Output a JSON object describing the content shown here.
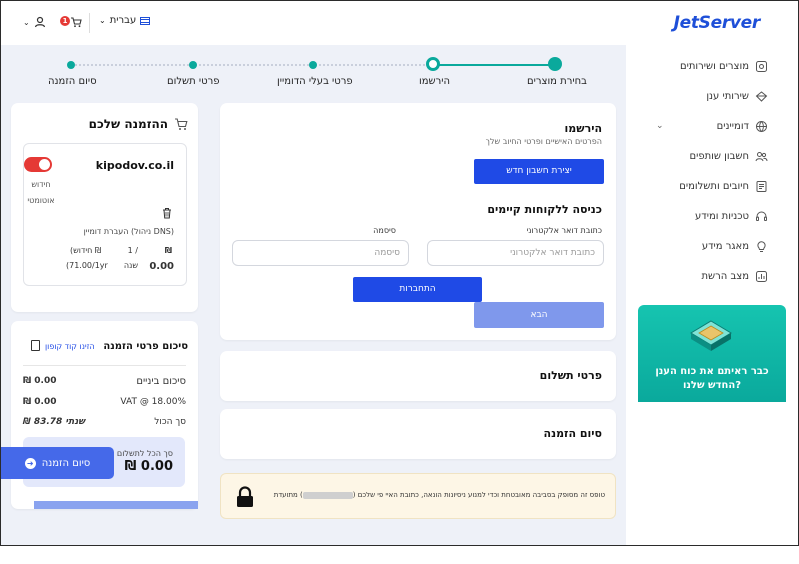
{
  "header": {
    "logo": "JetServer",
    "language": "עברית",
    "cart_badge": "1"
  },
  "sidebar": {
    "items": [
      {
        "label": "מוצרים ושירותים",
        "icon": "products-icon"
      },
      {
        "label": "שירותי ענן",
        "icon": "cloud-icon"
      },
      {
        "label": "דומיינים",
        "icon": "globe-icon"
      },
      {
        "label": "חשבון שותפים",
        "icon": "partners-icon"
      },
      {
        "label": "חיובים ותשלומים",
        "icon": "billing-icon"
      },
      {
        "label": "טכניות ומידע",
        "icon": "headset-icon"
      },
      {
        "label": "מאגר מידע",
        "icon": "bulb-icon"
      },
      {
        "label": "מצב הרשת",
        "icon": "network-status-icon"
      }
    ],
    "promo_text": "כבר ראיתם את כוח הענן החדש שלנו?"
  },
  "stepper": {
    "steps": [
      "בחירת מוצרים",
      "הירשמו",
      "פרטי בעלי הדומיין",
      "פרטי תשלום",
      "סיום הזמנה"
    ]
  },
  "registration": {
    "title": "הירשמו",
    "subtitle": "הפרטים האישיים ופרטי החיוב שלך",
    "create_account_button": "יצירת חשבון חדש",
    "login_title": "כניסה ללקוחות קיימים",
    "email_label": "כתובת דואר אלקטרוני",
    "email_placeholder": "כתובת דואר אלקטרוני",
    "password_label": "סיסמה",
    "password_placeholder": "סיסמה",
    "login_button": "התחברות",
    "next_button": "הבא"
  },
  "sections": {
    "payment_details": "פרטי תשלום",
    "order_completion": "סיום הזמנה"
  },
  "warning": {
    "text_before": "טופס זה מסופק בסביבה מאובטחת וכדי למנוע ניסיונות הונאה, כתובת האיי פי שלכם (",
    "text_after": ") מתועדת"
  },
  "order": {
    "title": "ההזמנה שלכם",
    "domain": "kipodov.co.il",
    "auto_renew_line1": "חידוש",
    "auto_renew_line2": "אוטומטי",
    "dns_label": "העברת דומיין (ניהול DNS)",
    "col_price_symbol": "₪",
    "col_qty": "1 /",
    "col_renewal": "(חידוש ₪",
    "price": "0.00",
    "period": "שנה",
    "renewal_price": "(71.00/1yr"
  },
  "summary": {
    "title": "סיכום פרטי הזמנה",
    "coupon_link": "הזינו קוד קופון",
    "subtotal_label": "סיכום ביניים",
    "subtotal_value": "₪ 0.00",
    "vat_label": "VAT @ 18.00%",
    "vat_value": "₪ 0.00",
    "total_label": "סך הכול",
    "total_value": "₪ 83.78 שנתי",
    "grand_label": "סך הכל לתשלום",
    "grand_value": "₪ 0.00",
    "finish_button": "סיום הזמנה"
  },
  "colors": {
    "brand_blue": "#1f4ae6",
    "teal": "#0aa99c",
    "toggle_red": "#e53935",
    "background": "#eef1f8"
  }
}
